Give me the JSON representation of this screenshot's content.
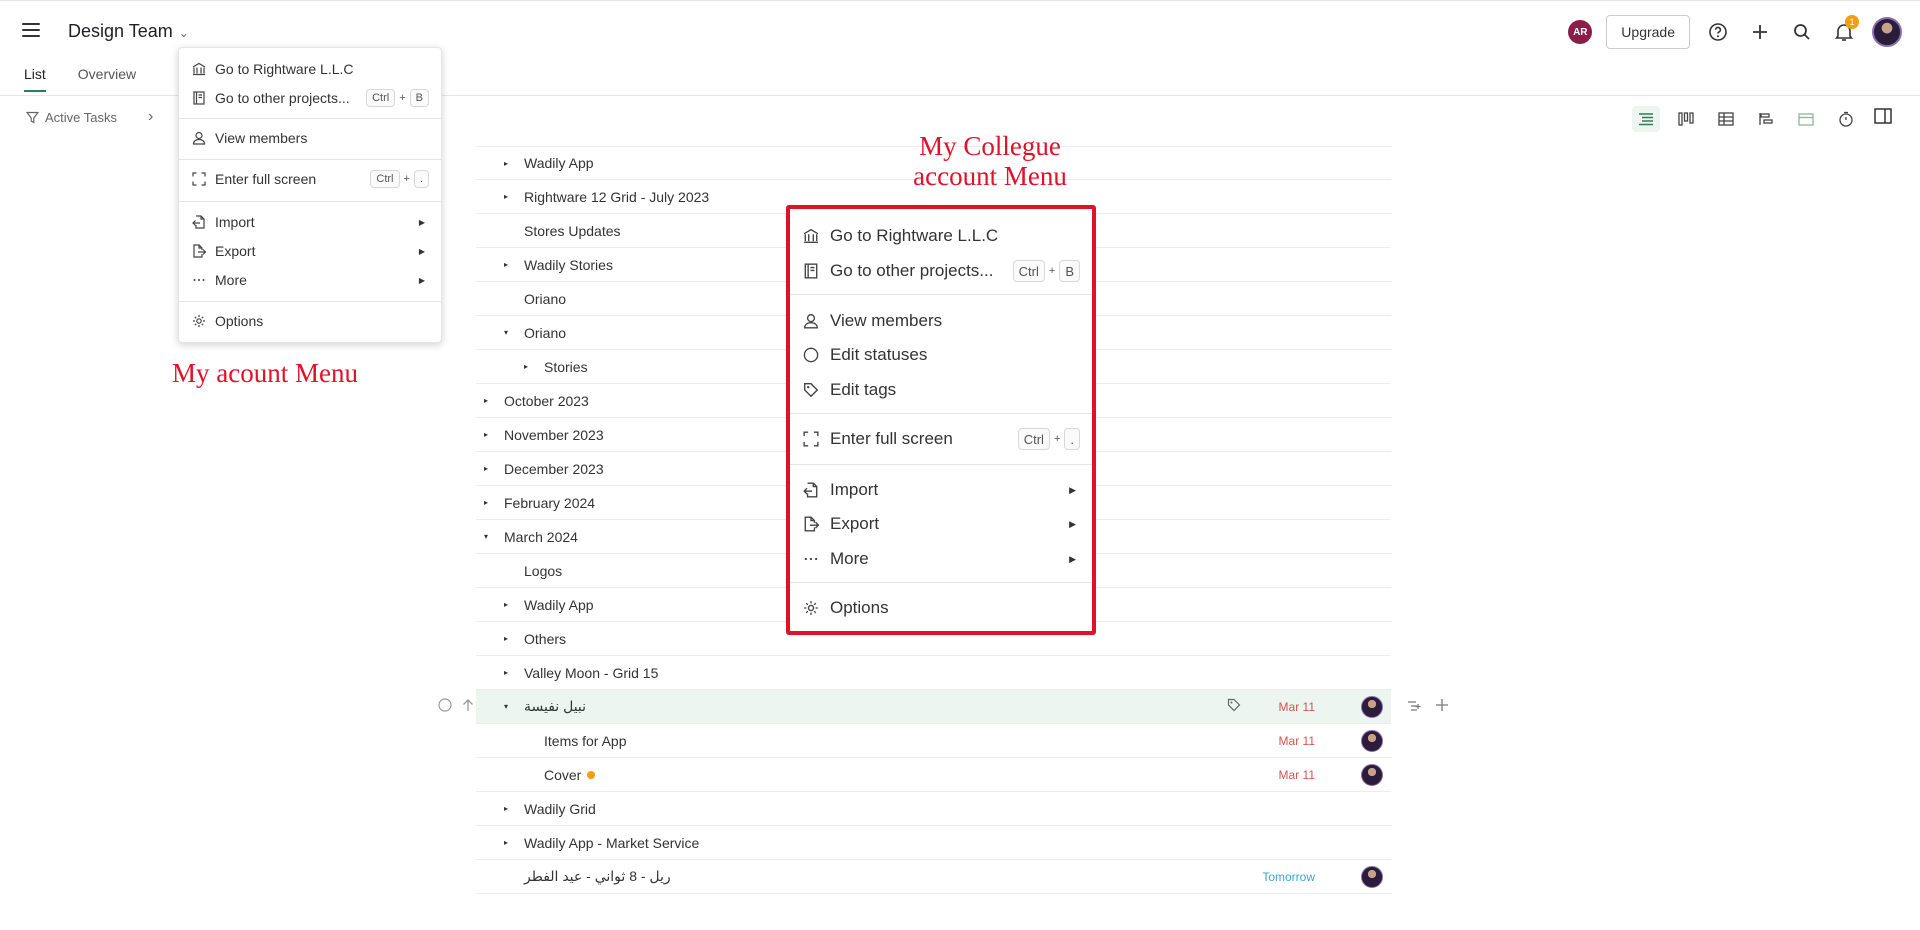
{
  "header": {
    "project_title": "Design Team",
    "user_initials": "AR",
    "upgrade_label": "Upgrade",
    "notification_count": "1"
  },
  "tabs": [
    {
      "label": "List",
      "active": true
    },
    {
      "label": "Overview",
      "active": false
    }
  ],
  "filter": {
    "label": "Active Tasks"
  },
  "small_menu": {
    "items": [
      {
        "label": "Go to Rightware L.L.C",
        "icon": "building-icon"
      },
      {
        "label": "Go to other projects...",
        "icon": "project-list-icon",
        "shortcut": [
          "Ctrl",
          "B"
        ]
      },
      {
        "label": "View members",
        "icon": "person-icon"
      },
      {
        "label": "Enter full screen",
        "icon": "fullscreen-icon",
        "shortcut": [
          "Ctrl",
          "."
        ]
      },
      {
        "label": "Import",
        "icon": "import-icon",
        "submenu": true
      },
      {
        "label": "Export",
        "icon": "export-icon",
        "submenu": true
      },
      {
        "label": "More",
        "icon": "ellipsis-icon",
        "submenu": true
      },
      {
        "label": "Options",
        "icon": "gear-icon"
      }
    ]
  },
  "big_menu": {
    "items": [
      {
        "label": "Go to Rightware L.L.C",
        "icon": "building-icon"
      },
      {
        "label": "Go to other projects...",
        "icon": "project-list-icon",
        "shortcut": [
          "Ctrl",
          "B"
        ]
      },
      {
        "label": "View members",
        "icon": "person-icon"
      },
      {
        "label": "Edit statuses",
        "icon": "circle-icon"
      },
      {
        "label": "Edit tags",
        "icon": "tag-icon"
      },
      {
        "label": "Enter full screen",
        "icon": "fullscreen-icon",
        "shortcut": [
          "Ctrl",
          "."
        ]
      },
      {
        "label": "Import",
        "icon": "import-icon",
        "submenu": true
      },
      {
        "label": "Export",
        "icon": "export-icon",
        "submenu": true
      },
      {
        "label": "More",
        "icon": "ellipsis-icon",
        "submenu": true
      },
      {
        "label": "Options",
        "icon": "gear-icon"
      }
    ]
  },
  "annotations": {
    "my_account_menu": "My acount Menu",
    "collegue_menu_line1": "My Collegue",
    "collegue_menu_line2": "account Menu"
  },
  "tasks": [
    {
      "label": "Wadily App",
      "indent": 1,
      "caret": "right"
    },
    {
      "label": "Rightware 12 Grid - July 2023",
      "indent": 1,
      "caret": "right"
    },
    {
      "label": "Stores Updates",
      "indent": 1,
      "caret": "none"
    },
    {
      "label": "Wadily Stories",
      "indent": 1,
      "caret": "right"
    },
    {
      "label": "Oriano",
      "indent": 1,
      "caret": "none"
    },
    {
      "label": "Oriano",
      "indent": 1,
      "caret": "down"
    },
    {
      "label": "Stories",
      "indent": 2,
      "caret": "right"
    },
    {
      "label": "October 2023",
      "indent": 0,
      "caret": "right"
    },
    {
      "label": "November 2023",
      "indent": 0,
      "caret": "right"
    },
    {
      "label": "December 2023",
      "indent": 0,
      "caret": "right"
    },
    {
      "label": "February 2024",
      "indent": 0,
      "caret": "right"
    },
    {
      "label": "March 2024",
      "indent": 0,
      "caret": "down"
    },
    {
      "label": "Logos",
      "indent": 1,
      "caret": "none"
    },
    {
      "label": "Wadily App",
      "indent": 1,
      "caret": "right"
    },
    {
      "label": "Others",
      "indent": 1,
      "caret": "right"
    },
    {
      "label": "Valley Moon - Grid 15",
      "indent": 1,
      "caret": "right"
    },
    {
      "label": "نبيل نفيسة",
      "indent": 1,
      "caret": "down",
      "date": "Mar 11",
      "avatar": true,
      "highlight": true
    },
    {
      "label": "Items for App",
      "indent": 2,
      "caret": "none",
      "date": "Mar 11",
      "avatar": true
    },
    {
      "label": "Cover",
      "indent": 2,
      "caret": "none",
      "date": "Mar 11",
      "avatar": true,
      "dot": true
    },
    {
      "label": "Wadily Grid",
      "indent": 1,
      "caret": "right"
    },
    {
      "label": "Wadily App - Market Service",
      "indent": 1,
      "caret": "right"
    },
    {
      "label": "ريل - 8 ثواني - عيد الفطر",
      "indent": 1,
      "caret": "none",
      "date": "Tomorrow",
      "date_color": "blue",
      "avatar": true
    }
  ],
  "colors": {
    "accent": "#2e7d5b",
    "annotation_red": "#e0122a",
    "date_red": "#d9534f",
    "date_blue": "#3ba4d6",
    "notification": "#f59e0b",
    "user_badge": "#8b1d4a"
  }
}
